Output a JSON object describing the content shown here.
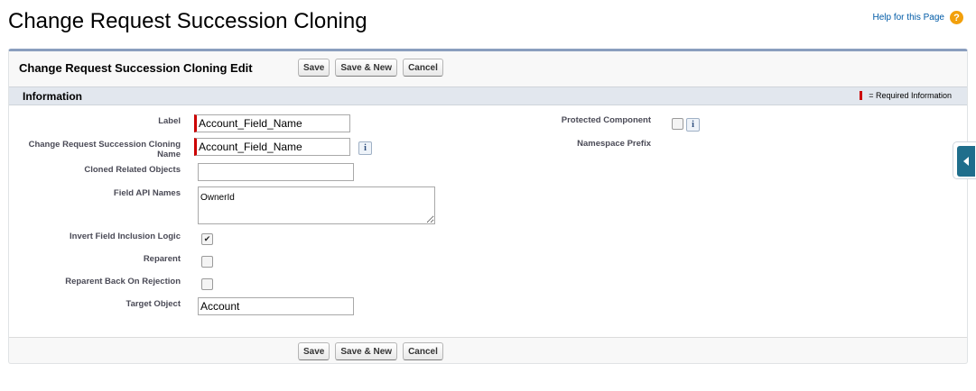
{
  "page": {
    "title": "Change Request Succession Cloning",
    "help_link": "Help for this Page",
    "help_icon": "?"
  },
  "edit_block": {
    "title": "Change Request Succession Cloning Edit",
    "buttons": {
      "save": "Save",
      "save_new": "Save & New",
      "cancel": "Cancel"
    }
  },
  "section": {
    "title": "Information",
    "required_legend": "= Required Information"
  },
  "fields": {
    "label": {
      "label": "Label",
      "value": "Account_Field_Name"
    },
    "cloning_name": {
      "label": "Change Request Succession Cloning Name",
      "value": "Account_Field_Name"
    },
    "cloned_related_objects": {
      "label": "Cloned Related Objects",
      "value": ""
    },
    "field_api_names": {
      "label": "Field API Names",
      "value": "OwnerId"
    },
    "invert_logic": {
      "label": "Invert Field Inclusion Logic",
      "checked": "✔"
    },
    "reparent": {
      "label": "Reparent"
    },
    "reparent_back": {
      "label": "Reparent Back On Rejection"
    },
    "target_object": {
      "label": "Target Object",
      "value": "Account"
    },
    "protected_component": {
      "label": "Protected Component"
    },
    "namespace_prefix": {
      "label": "Namespace Prefix"
    },
    "info_glyph": "i"
  },
  "colors": {
    "required": "#cc0000",
    "help_icon": "#f2a00c",
    "side_tab": "#1f6e8c",
    "panel_border": "#8a9ebe"
  }
}
